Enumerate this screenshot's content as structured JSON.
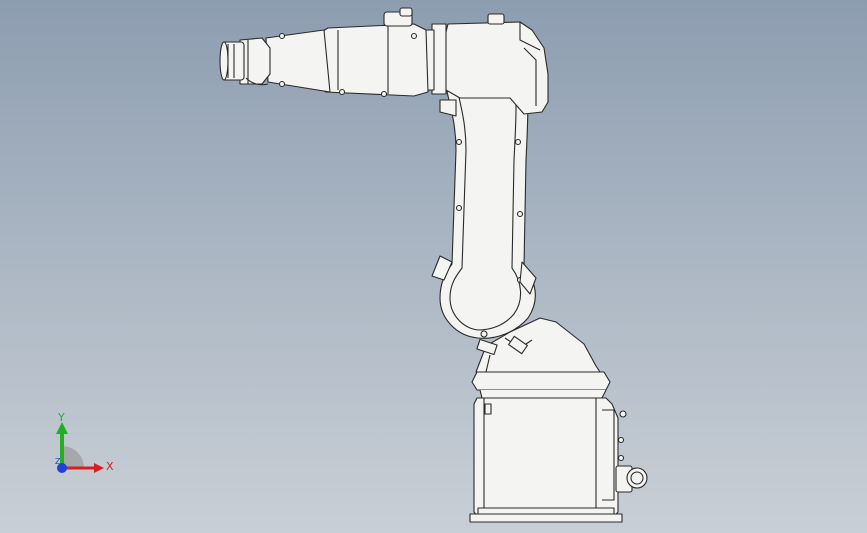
{
  "viewport": {
    "background_top": "#8d9db0",
    "background_bottom": "#c9cfd6"
  },
  "model": {
    "fill": "#f4f4f2",
    "edge": "#2a2a2a"
  },
  "triad": {
    "x_label": "X",
    "y_label": "Y",
    "z_label": "Z",
    "x_color": "#d42020",
    "y_color": "#22b022",
    "z_color": "#2040d8"
  }
}
